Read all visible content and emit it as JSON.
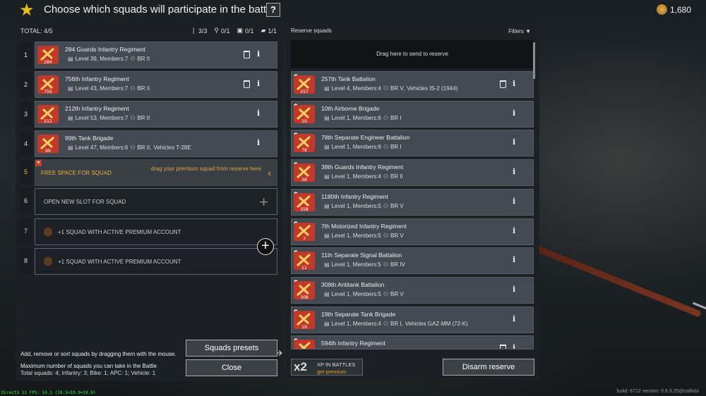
{
  "header": {
    "title": "Choose which squads will participate in the battle",
    "help": "?",
    "gold": "1,680"
  },
  "left": {
    "total": "TOTAL: 4/5",
    "counts": [
      {
        "icon": "infantry-icon",
        "text": "3/3"
      },
      {
        "icon": "bike-icon",
        "text": "0/1"
      },
      {
        "icon": "apc-icon",
        "text": "0/1"
      },
      {
        "icon": "tank-icon",
        "text": "1/1"
      }
    ],
    "squads": [
      {
        "num": "1",
        "name": "284 Guards Infantry Regiment",
        "info": "Level 39, Members:7",
        "br": "BR II",
        "vehicle": "",
        "badge": "284"
      },
      {
        "num": "2",
        "name": "756th Infantry Regiment",
        "info": "Level 43, Members:7",
        "br": "BR II",
        "vehicle": "",
        "badge": "756"
      },
      {
        "num": "3",
        "name": "212th Infantry Regiment",
        "info": "Level 53, Members:7",
        "br": "BR II",
        "vehicle": "",
        "badge": "212"
      },
      {
        "num": "4",
        "name": "99th Tank Brigade",
        "info": "Level 47, Members:6",
        "br": "BR II,",
        "vehicle": "Vehicles T-28E",
        "badge": "99"
      }
    ],
    "free": {
      "num": "5",
      "text": "FREE SPACE FOR SQUAD",
      "hint": "drag your premium squad from reserve here"
    },
    "open": {
      "num": "6",
      "text": "OPEN NEW SLOT FOR SQUAD"
    },
    "premium": [
      {
        "num": "7",
        "text": "+1 SQUAD WITH ACTIVE PREMIUM ACCOUNT"
      },
      {
        "num": "8",
        "text": "+1 SQUAD WITH ACTIVE PREMIUM ACCOUNT"
      }
    ],
    "hint1": "Add, remove or sort squads by dragging them with the mouse.",
    "hint2": "Maximum number of squads you can take in the Battle",
    "hint3": "Total squads: 4; Infantry: 3; Bike: 1; APC: 1; Vehicle: 1",
    "presets": "Squads presets",
    "close": "Close"
  },
  "right": {
    "title": "Reserve squads",
    "filters": "Filters",
    "drop": "Drag here to send to reserve",
    "squads": [
      {
        "name": "257th Tank Battalion",
        "info": "Level 4, Members:4",
        "br": "BR V,",
        "vehicle": "Vehicles IS-2 (1944)",
        "badge": "257",
        "color": "#c0392b"
      },
      {
        "name": "10th Airborne Brigade",
        "info": "Level 1, Members:6",
        "br": "BR I",
        "vehicle": "",
        "badge": "10",
        "color": "#c0392b"
      },
      {
        "name": "78th Separate Engineer Battalion",
        "info": "Level 1, Members:6",
        "br": "BR I",
        "vehicle": "",
        "badge": "78",
        "color": "#c0392b"
      },
      {
        "name": "38th Guards Infantry Regiment",
        "info": "Level 1, Members:4",
        "br": "BR II",
        "vehicle": "",
        "badge": "38",
        "color": "#c0392b"
      },
      {
        "name": "1180th Infantry Regiment",
        "info": "Level 1, Members:5",
        "br": "BR V",
        "vehicle": "",
        "badge": "358",
        "color": "#c0392b"
      },
      {
        "name": "7th Motorized Infantry Regiment",
        "info": "Level 1, Members:5",
        "br": "BR V",
        "vehicle": "",
        "badge": "7",
        "color": "#c0392b"
      },
      {
        "name": "11th Separate Signal Battalion",
        "info": "Level 1, Members:5",
        "br": "BR IV",
        "vehicle": "",
        "badge": "11",
        "color": "#c0392b"
      },
      {
        "name": "308th Antitank Battalion",
        "info": "Level 1, Members:5",
        "br": "BR V",
        "vehicle": "",
        "badge": "308",
        "color": "#c0392b"
      },
      {
        "name": "19th Separate Tank Brigade",
        "info": "Level 1, Members:4",
        "br": "BR I,",
        "vehicle": "Vehicles GAZ-MM (72-K)",
        "badge": "19",
        "color": "#c0392b"
      },
      {
        "name": "594th Infantry Regiment",
        "info": "",
        "br": "",
        "vehicle": "",
        "badge": "",
        "color": "#c0392b"
      }
    ],
    "xp_mult": "x2",
    "xp_label": "XP IN BATTLES",
    "xp_link": "get premium",
    "disarm": "Disarm reserve"
  },
  "footer": {
    "left": "DirectX 11 FPS: 53.1 (18.5<19.9<18.8)",
    "right": "build: 6712 version: 0.6.9.25@callisto"
  },
  "colors": {
    "accent": "#e8b040",
    "panel": "#1c2126",
    "slot": "#434a52"
  }
}
